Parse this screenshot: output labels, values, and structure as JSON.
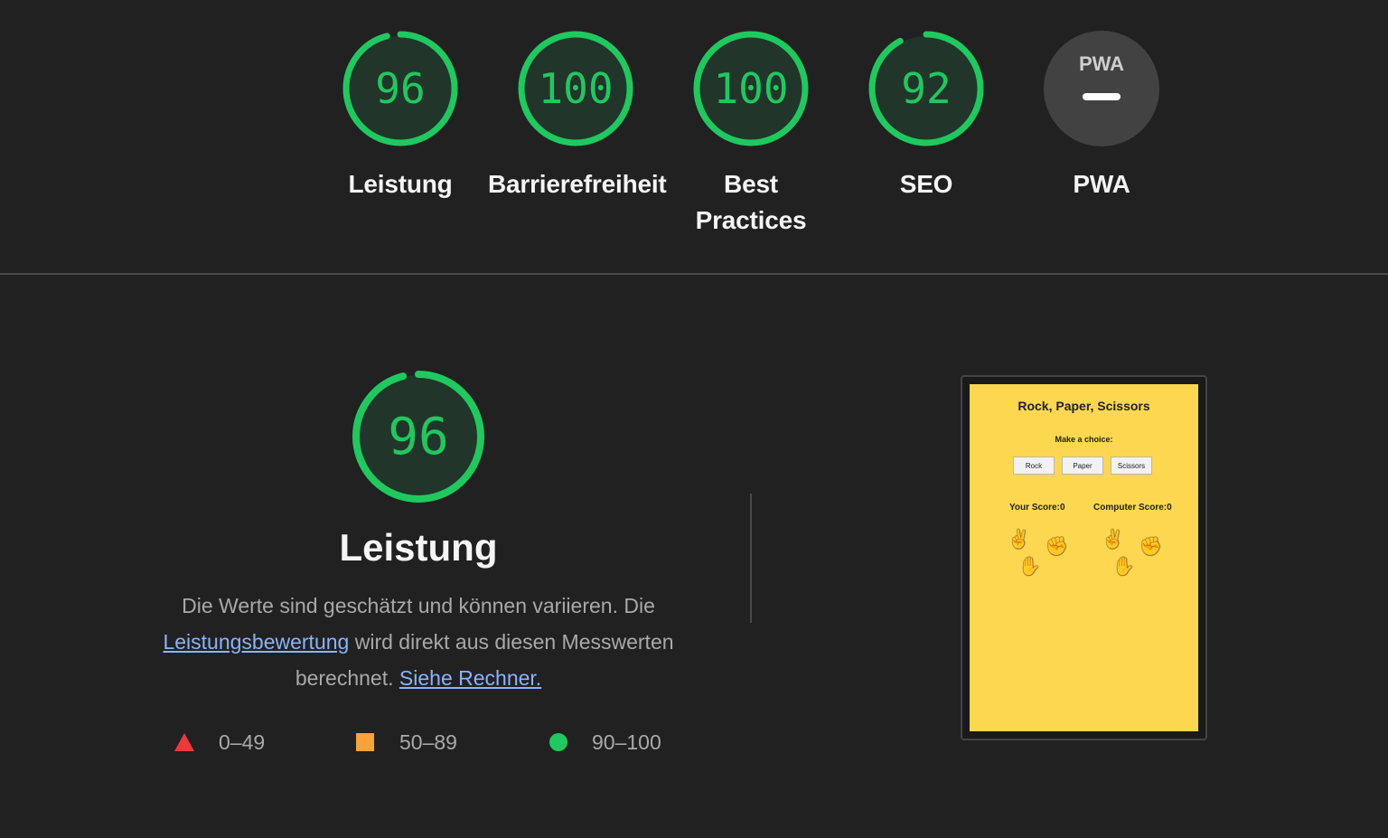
{
  "categories": [
    {
      "id": "performance",
      "score": "96",
      "label": "Leistung",
      "fraction": 0.96
    },
    {
      "id": "accessibility",
      "score": "100",
      "label": "Barrierefreiheit",
      "fraction": 1.0
    },
    {
      "id": "best-practices",
      "score": "100",
      "label": "Best Practices",
      "fraction": 1.0
    },
    {
      "id": "seo",
      "score": "92",
      "label": "SEO",
      "fraction": 0.92
    },
    {
      "id": "pwa",
      "badge": "PWA",
      "score_symbol": "—",
      "label": "PWA"
    }
  ],
  "performance": {
    "score": "96",
    "fraction": 0.96,
    "title": "Leistung",
    "desc_part1": "Die Werte sind geschätzt und können variieren. Die",
    "link_scoring": "Leistungsbewertung",
    "desc_part2": "wird direkt aus diesen Messwerten berechnet.",
    "link_calculator": "Siehe Rechner."
  },
  "legend": {
    "fail": "0–49",
    "average": "50–89",
    "pass": "90–100"
  },
  "screenshot": {
    "title": "Rock, Paper, Scissors",
    "make_choice": "Make a choice:",
    "buttons": [
      "Rock",
      "Paper",
      "Scissors"
    ],
    "your_score": "Your Score:0",
    "computer_score": "Computer Score:0"
  },
  "colors": {
    "pass": "#1ec95f",
    "average": "#f7a23b",
    "fail": "#ea3a3a",
    "background": "#212121",
    "link": "#8ab4f8",
    "screenshot_bg": "#fdd74f"
  }
}
